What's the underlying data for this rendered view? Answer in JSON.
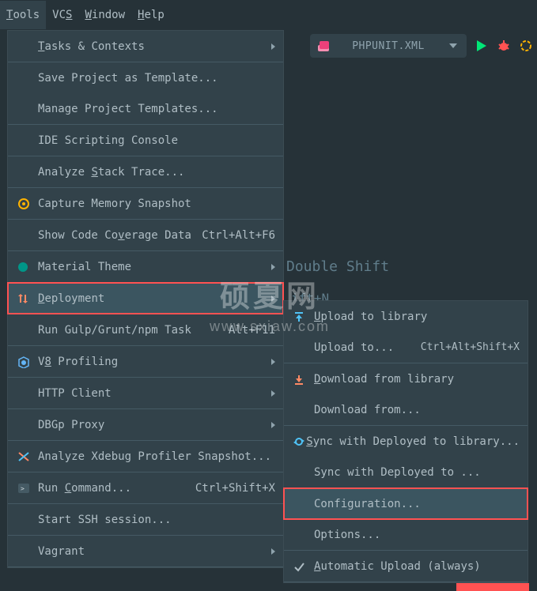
{
  "menubar": {
    "tools_t": "T",
    "tools_rest": "ools",
    "vcs_vc": "VC",
    "vcs_s": "S",
    "window_w": "W",
    "window_rest": "indow",
    "help_h": "H",
    "help_rest": "elp"
  },
  "toolbar": {
    "config_label": "PHPUNIT.XML"
  },
  "tools_menu": {
    "tasks_t": "T",
    "tasks_rest": "asks & Contexts",
    "save_tpl": "Save Project as Template...",
    "manage_tpl": "Manage Project Templates...",
    "ide_console": "IDE Scripting Console",
    "analyze_stack_pre": "Analyze ",
    "analyze_stack_s": "S",
    "analyze_stack_rest": "tack Trace...",
    "capture_mem": "Capture Memory Snapshot",
    "coverage_pre": "Show Code Co",
    "coverage_v": "v",
    "coverage_rest": "erage Data",
    "coverage_short": "Ctrl+Alt+F6",
    "material_theme": "Material Theme",
    "deploy_d": "D",
    "deploy_rest": "eployment",
    "gulp": "Run Gulp/Grunt/npm Task",
    "gulp_short": "Alt+F11",
    "v8_v": "V",
    "v8_8": "8",
    "v8_rest": " Profiling",
    "http_client": "HTTP Client",
    "dbgp": "DBGp Proxy",
    "xdebug": "Analyze Xdebug Profiler Snapshot...",
    "run_pre": "Run ",
    "run_c": "C",
    "run_rest": "ommand...",
    "run_short": "Ctrl+Shift+X",
    "ssh": "Start SSH session...",
    "vagrant": "Vagrant"
  },
  "deploy_menu": {
    "upload_u": "U",
    "upload_rest": "pload to library",
    "upload_to": "Upload to...",
    "upload_to_short": "Ctrl+Alt+Shift+X",
    "download_d": "D",
    "download_rest": "ownload from library",
    "download_from": "Download from...",
    "sync_s": "S",
    "sync_rest": "ync with Deployed to library...",
    "sync_with": "Sync with Deployed to ...",
    "configuration": "Configuration...",
    "options": "Options...",
    "auto_a": "A",
    "auto_rest": "utomatic Upload (always)"
  },
  "bg_hints": {
    "double_shift": "Double Shift",
    "shift_n": "ift+N"
  },
  "watermark": {
    "title": "硕夏网",
    "sub": "www.sxiaw.com"
  }
}
